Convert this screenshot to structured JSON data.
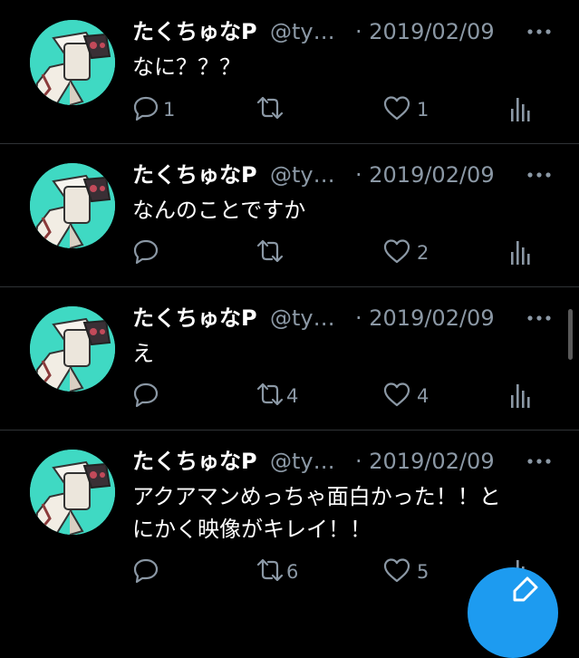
{
  "colors": {
    "background": "#000000",
    "text_primary": "#ffffff",
    "text_secondary": "#8b98a5",
    "divider": "#2f3336",
    "avatar_bg": "#3fd9c3",
    "accent": "#1d9bf0"
  },
  "tweets": [
    {
      "name": "たくちゅなP",
      "handle": "@ty…",
      "date": "· 2019/02/09",
      "text": "なに？？？",
      "replies": "1",
      "retweets": "",
      "likes": "1",
      "icons": [
        "reply-icon",
        "retweet-icon",
        "like-icon",
        "views-icon",
        "more-icon"
      ]
    },
    {
      "name": "たくちゅなP",
      "handle": "@ty…",
      "date": "· 2019/02/09",
      "text": "なんのことですか",
      "replies": "",
      "retweets": "",
      "likes": "2",
      "icons": [
        "reply-icon",
        "retweet-icon",
        "like-icon",
        "views-icon",
        "more-icon"
      ]
    },
    {
      "name": "たくちゅなP",
      "handle": "@ty…",
      "date": "· 2019/02/09",
      "text": "え",
      "replies": "",
      "retweets": "4",
      "likes": "4",
      "icons": [
        "reply-icon",
        "retweet-icon",
        "like-icon",
        "views-icon",
        "more-icon"
      ]
    },
    {
      "name": "たくちゅなP",
      "handle": "@ty…",
      "date": "· 2019/02/09",
      "text": "アクアマンめっちゃ面白かった！！と\nにかく映像がキレイ！！",
      "replies": "",
      "retweets": "6",
      "likes": "5",
      "icons": [
        "reply-icon",
        "retweet-icon",
        "like-icon",
        "views-icon",
        "more-icon"
      ]
    }
  ],
  "compose_button": {
    "icon": "compose-icon"
  }
}
